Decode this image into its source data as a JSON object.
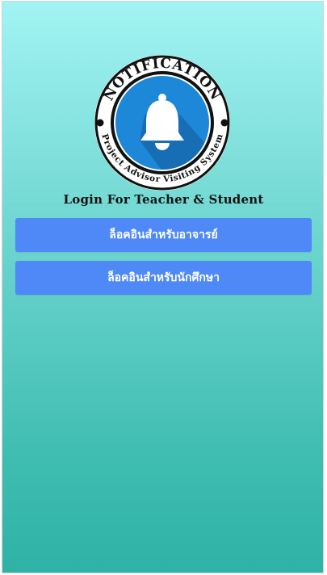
{
  "logo": {
    "top_text": "NOTIFICATION",
    "bottom_text": "Project Advisor Visiting System",
    "icon": "bell-icon",
    "ring_color": "#111111",
    "circle_color": "#1e88d8"
  },
  "tagline": "Login For Teacher & Student",
  "buttons": {
    "teacher_login": "ล็อคอินสำหรับอาจารย์",
    "student_login": "ล็อคอินสำหรับนักศึกษา"
  },
  "colors": {
    "button": "#4f88f7",
    "background_top": "#a2f4f3",
    "background_bottom": "#2fb2a6"
  }
}
